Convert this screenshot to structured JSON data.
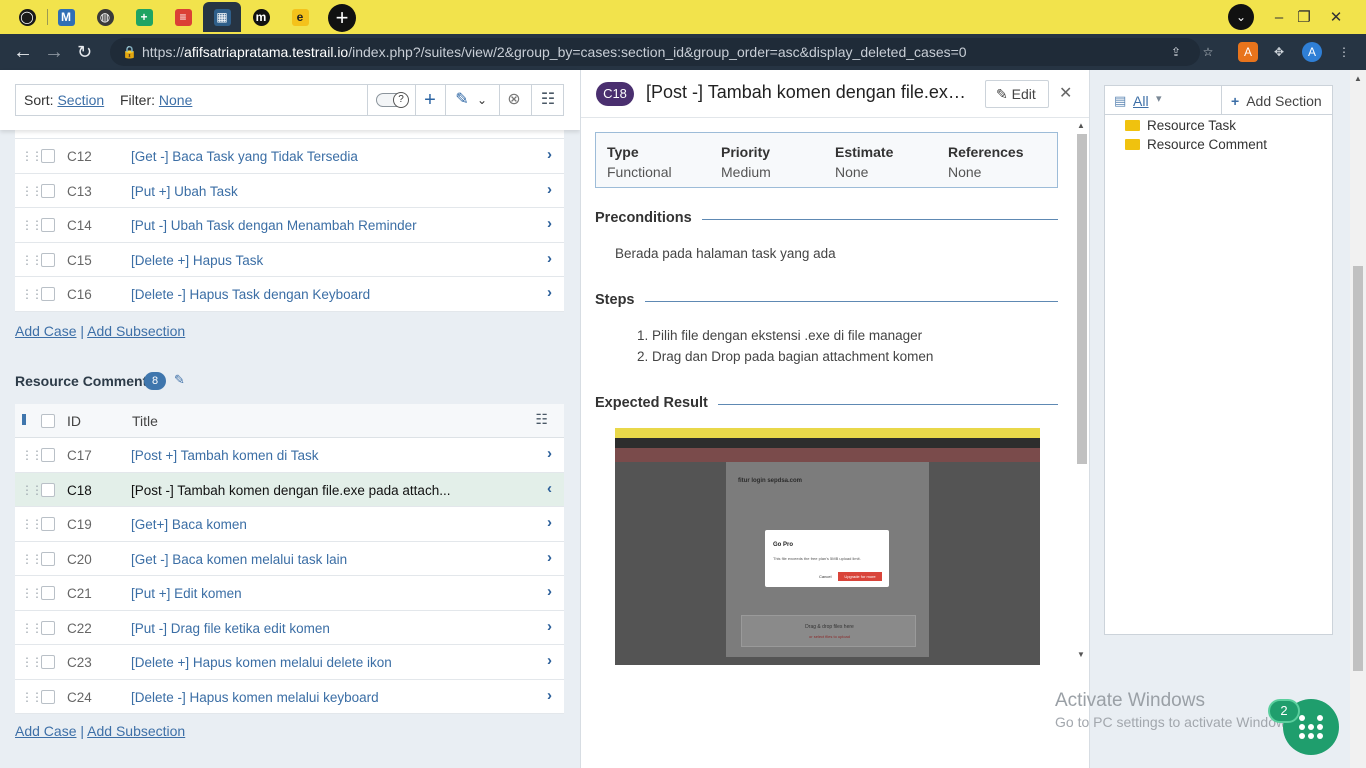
{
  "browser": {
    "url_prefix": "https://",
    "url_host": "afifsatriapratama.testrail.io",
    "url_path": "/index.php?/suites/view/2&group_by=cases:section_id&group_order=asc&display_deleted_cases=0",
    "profile_initial": "A"
  },
  "toolbar": {
    "sort_label": "Sort:",
    "sort_value": "Section",
    "filter_label": "Filter:",
    "filter_value": "None"
  },
  "section_task": {
    "cases": [
      {
        "id": "C12",
        "title": "[Get -] Baca Task yang Tidak Tersedia"
      },
      {
        "id": "C13",
        "title": "[Put +] Ubah Task"
      },
      {
        "id": "C14",
        "title": "[Put -] Ubah Task dengan Menambah Reminder"
      },
      {
        "id": "C15",
        "title": "[Delete +] Hapus Task"
      },
      {
        "id": "C16",
        "title": "[Delete -] Hapus Task dengan Keyboard"
      }
    ],
    "add_case": "Add Case",
    "sep": "|",
    "add_subsection": "Add Subsection"
  },
  "section_comment": {
    "name": "Resource Comment",
    "count": "8",
    "col_id": "ID",
    "col_title": "Title",
    "cases": [
      {
        "id": "C17",
        "title": "[Post +] Tambah komen di Task"
      },
      {
        "id": "C18",
        "title": "[Post -] Tambah komen dengan file.exe pada attach..."
      },
      {
        "id": "C19",
        "title": "[Get+] Baca komen"
      },
      {
        "id": "C20",
        "title": "[Get -] Baca komen melalui task lain"
      },
      {
        "id": "C21",
        "title": "[Put +] Edit komen"
      },
      {
        "id": "C22",
        "title": "[Put -] Drag file ketika edit komen"
      },
      {
        "id": "C23",
        "title": "[Delete +] Hapus komen melalui delete ikon"
      },
      {
        "id": "C24",
        "title": "[Delete -] Hapus komen melalui keyboard"
      }
    ],
    "add_case": "Add Case",
    "sep": "|",
    "add_subsection": "Add Subsection"
  },
  "detail": {
    "case_id": "C18",
    "title": "[Post -] Tambah komen dengan file.exe pada attachment",
    "edit_label": "Edit",
    "fields": [
      {
        "key": "Type",
        "value": "Functional"
      },
      {
        "key": "Priority",
        "value": "Medium"
      },
      {
        "key": "Estimate",
        "value": "None"
      },
      {
        "key": "References",
        "value": "None"
      }
    ],
    "preconditions_label": "Preconditions",
    "preconditions_text": "Berada pada halaman task yang ada",
    "steps_label": "Steps",
    "steps": [
      "1. Pilih file dengan ekstensi .exe di file manager",
      "2. Drag dan Drop pada bagian attachment komen"
    ],
    "expected_label": "Expected Result",
    "screenshot": {
      "panel_title": "fitur login sepdsa.com",
      "dialog_title": "Go Pro",
      "dialog_text": "This file exceeds the free plan's 5MB upload limit.",
      "cancel": "Cancel",
      "upgrade": "Upgrade for more",
      "drop_text": "Drag & drop files here",
      "drop_sub": "or select files to upload"
    }
  },
  "tree": {
    "filter_value": "All",
    "add_section": "Add Section",
    "items": [
      "Resource Task",
      "Resource Comment"
    ]
  },
  "overlay": {
    "watermark_title": "Activate Windows",
    "watermark_sub": "Go to PC settings to activate Windows.",
    "help_count": "2"
  },
  "colors": {
    "tabbar": "#f2e34c",
    "addrbar": "#263443",
    "accent": "#3d6fa7",
    "case_pill": "#4a2f6f",
    "help": "#1f9e6d"
  }
}
